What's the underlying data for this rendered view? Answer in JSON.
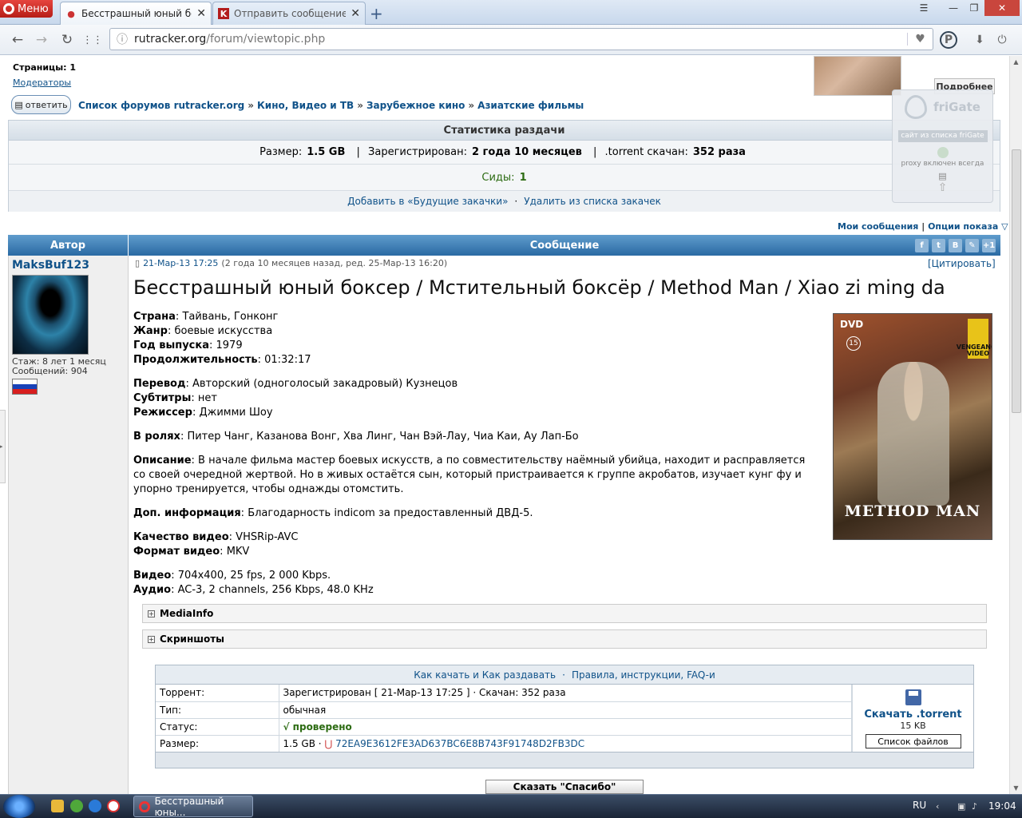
{
  "browser": {
    "menu_label": "Меню",
    "tabs": [
      {
        "title": "Бесстрашный юный бок",
        "favicon": "rutracker-icon",
        "active": true
      },
      {
        "title": "Отправить сообщение: in",
        "favicon": "K",
        "active": false
      }
    ],
    "url_host": "rutracker.org",
    "url_path": "/forum/viewtopic.php"
  },
  "topic": {
    "pages_label": "Страницы:",
    "pages_value": "1",
    "moderators": "Модераторы",
    "reply_label": "ответить",
    "breadcrumbs": [
      "Список форумов rutracker.org",
      "Кино, Видео и ТВ",
      "Зарубежное кино",
      "Азиатские фильмы"
    ],
    "more_label": "Подробнее"
  },
  "stats": {
    "header": "Статистика раздачи",
    "size_label": "Размер:",
    "size_value": "1.5 GB",
    "registered_label": "Зарегистрирован:",
    "registered_value": "2 года 10 месяцев",
    "downloaded_label": ".torrent скачан:",
    "downloaded_value": "352 раза",
    "seeds_label": "Сиды:",
    "seeds_value": "1",
    "add_future": "Добавить в «Будущие закачки»",
    "remove_list": "Удалить из списка закачек"
  },
  "options": {
    "my_messages": "Мои сообщения",
    "display_options": "Опции показа"
  },
  "post_header": {
    "author": "Автор",
    "message": "Сообщение"
  },
  "author": {
    "name": "MaksBuf123",
    "tenure": "Стаж: 8 лет 1 месяц",
    "messages": "Сообщений: 904"
  },
  "post": {
    "date": "21-Мар-13 17:25",
    "ago": "(2 года 10 месяцев назад, ред. 25-Мар-13 16:20)",
    "quote": "[Цитировать]",
    "title": "Бесстрашный юный боксер / Мстительный боксёр / Method Man / Xiao zi ming da",
    "fields": [
      [
        {
          "k": "Страна",
          "v": "Тайвань, Гонконг"
        },
        {
          "k": "Жанр",
          "v": "боевые искусства"
        },
        {
          "k": "Год выпуска",
          "v": "1979"
        },
        {
          "k": "Продолжительность",
          "v": "01:32:17"
        }
      ],
      [
        {
          "k": "Перевод",
          "v": "Авторский (одноголосый закадровый) Кузнецов"
        },
        {
          "k": "Субтитры",
          "v": "нет"
        },
        {
          "k": "Режиссер",
          "v": "Джимми Шоу"
        }
      ],
      [
        {
          "k": "В ролях",
          "v": "Питер Чанг, Казанова Вонг, Хва Линг, Чан Вэй-Лау, Чиа Каи, Ау Лап-Бо"
        }
      ],
      [
        {
          "k": "Описание",
          "v": "В начале фильма мастер боевых искусств, а по совместительству наёмный убийца, находит и расправляется со своей очередной жертвой. Но в живых остаётся сын, который пристраивается к группе акробатов, изучает кунг фу и упорно тренируется, чтобы однажды отомстить."
        }
      ],
      [
        {
          "k": "Доп. информация",
          "v": "Благодарность indicom за предоставленный ДВД-5."
        }
      ],
      [
        {
          "k": "Качество видео",
          "v": "VHSRip-AVC"
        },
        {
          "k": "Формат видео",
          "v": "MKV"
        }
      ],
      [
        {
          "k": "Видео",
          "v": "704x400, 25 fps, 2 000 Kbps."
        },
        {
          "k": "Аудио",
          "v": "AC-3, 2 channels, 256 Kbps, 48.0 KHz"
        }
      ]
    ],
    "poster": {
      "dvd": "DVD",
      "age": "15",
      "side": "VENGEANCE VIDEO",
      "title": "METHOD MAN"
    },
    "spoiler_mediainfo": "MediaInfo",
    "spoiler_screens": "Скриншоты"
  },
  "torrent": {
    "how_to": "Как качать и Как раздавать",
    "rules": "Правила, инструкции, FAQ-и",
    "rows": [
      {
        "label": "Торрент:",
        "value": "Зарегистрирован  [ 21-Мар-13 17:25 ]  ·  Скачан: 352 раза"
      },
      {
        "label": "Тип:",
        "value": "обычная"
      },
      {
        "label": "Статус:",
        "value": "√  проверено"
      },
      {
        "label": "Размер:",
        "value": "1.5 GB  ·"
      }
    ],
    "hash": "72EA9E3612FE3AD637BC6E8B743F91748D2FB3DC",
    "download": "Скачать .torrent",
    "download_size": "15 KB",
    "file_list": "Список файлов",
    "thanks": "Сказать \"Спасибо\""
  },
  "frigate": {
    "name": "friGate",
    "site": "сайт из списка friGate",
    "proxy": "proxy включен всегда"
  },
  "taskbar": {
    "active_title": "Бесстрашный юны...",
    "lang": "RU",
    "clock": "19:04"
  }
}
